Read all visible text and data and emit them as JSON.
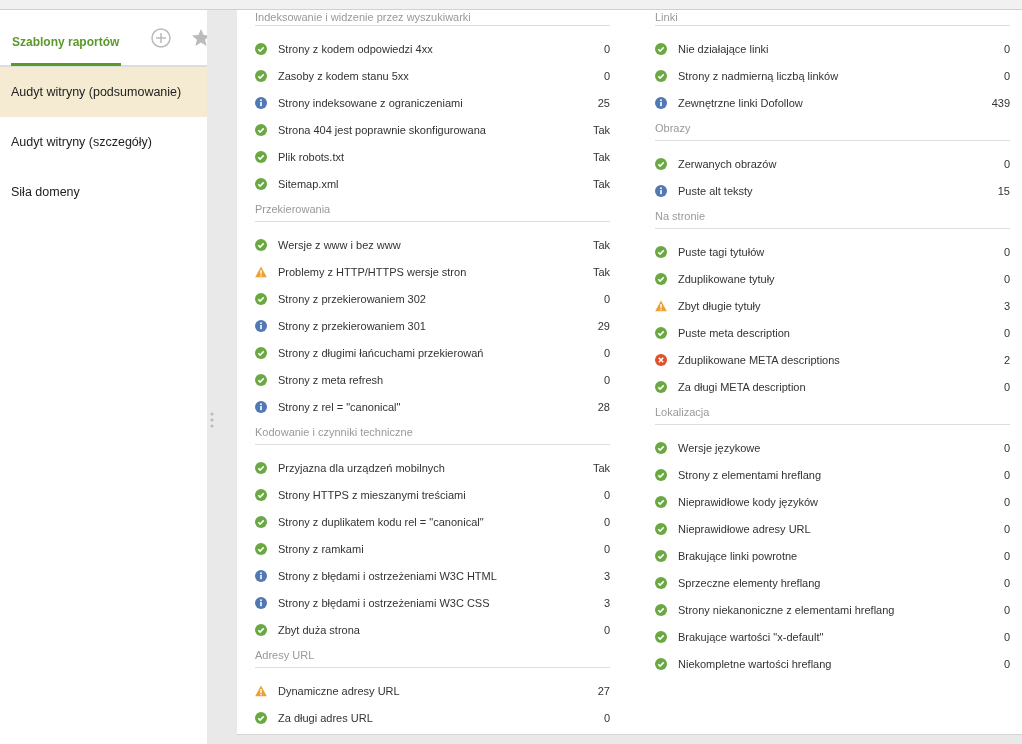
{
  "sidebar": {
    "tabs": [
      {
        "label": "Szablony raportów",
        "selected": true
      }
    ],
    "items": [
      {
        "label": "Audyt witryny (podsumowanie)",
        "selected": true
      },
      {
        "label": "Audyt witryny (szczegóły)",
        "selected": false
      },
      {
        "label": "Siła domeny",
        "selected": false
      }
    ]
  },
  "report": {
    "left_column": [
      {
        "title": "Indeksowanie i widzenie przez wyszukiwarki",
        "rows": [
          {
            "kind": "ok",
            "label": "Strony z kodem odpowiedzi 4xx",
            "value": "0"
          },
          {
            "kind": "ok",
            "label": "Zasoby z kodem stanu 5xx",
            "value": "0"
          },
          {
            "kind": "info",
            "label": "Strony indeksowane z ograniczeniami",
            "value": "25"
          },
          {
            "kind": "ok",
            "label": "Strona 404 jest poprawnie skonfigurowana",
            "value": "Tak"
          },
          {
            "kind": "ok",
            "label": "Plik robots.txt",
            "value": "Tak"
          },
          {
            "kind": "ok",
            "label": "Sitemap.xml",
            "value": "Tak"
          }
        ]
      },
      {
        "title": "Przekierowania",
        "rows": [
          {
            "kind": "ok",
            "label": "Wersje z www i bez www",
            "value": "Tak"
          },
          {
            "kind": "warning",
            "label": "Problemy z HTTP/HTTPS wersje stron",
            "value": "Tak"
          },
          {
            "kind": "ok",
            "label": "Strony z przekierowaniem 302",
            "value": "0"
          },
          {
            "kind": "info",
            "label": "Strony z przekierowaniem 301",
            "value": "29"
          },
          {
            "kind": "ok",
            "label": "Strony z długimi łańcuchami przekierowań",
            "value": "0"
          },
          {
            "kind": "ok",
            "label": "Strony z meta refresh",
            "value": "0"
          },
          {
            "kind": "info",
            "label": "Strony z rel = \"canonical\"",
            "value": "28"
          }
        ]
      },
      {
        "title": "Kodowanie i czynniki techniczne",
        "rows": [
          {
            "kind": "ok",
            "label": "Przyjazna dla urządzeń mobilnych",
            "value": "Tak"
          },
          {
            "kind": "ok",
            "label": "Strony HTTPS z mieszanymi treściami",
            "value": "0"
          },
          {
            "kind": "ok",
            "label": "Strony z duplikatem kodu rel = \"canonical\"",
            "value": "0"
          },
          {
            "kind": "ok",
            "label": "Strony z ramkami",
            "value": "0"
          },
          {
            "kind": "info",
            "label": "Strony z błędami i ostrzeżeniami W3C HTML",
            "value": "3"
          },
          {
            "kind": "info",
            "label": "Strony z błędami i ostrzeżeniami W3C CSS",
            "value": "3"
          },
          {
            "kind": "ok",
            "label": "Zbyt duża strona",
            "value": "0"
          }
        ]
      },
      {
        "title": "Adresy URL",
        "rows": [
          {
            "kind": "warning",
            "label": "Dynamiczne adresy URL",
            "value": "27"
          },
          {
            "kind": "ok",
            "label": "Za długi adres URL",
            "value": "0"
          }
        ]
      }
    ],
    "right_column": [
      {
        "title": "Linki",
        "rows": [
          {
            "kind": "ok",
            "label": "Nie działające linki",
            "value": "0"
          },
          {
            "kind": "ok",
            "label": "Strony z nadmierną liczbą linków",
            "value": "0"
          },
          {
            "kind": "info",
            "label": "Zewnętrzne linki Dofollow",
            "value": "439"
          }
        ]
      },
      {
        "title": "Obrazy",
        "rows": [
          {
            "kind": "ok",
            "label": "Zerwanych obrazów",
            "value": "0"
          },
          {
            "kind": "info",
            "label": "Puste alt teksty",
            "value": "15"
          }
        ]
      },
      {
        "title": "Na stronie",
        "rows": [
          {
            "kind": "ok",
            "label": "Puste tagi tytułów",
            "value": "0"
          },
          {
            "kind": "ok",
            "label": "Zduplikowane tytuły",
            "value": "0"
          },
          {
            "kind": "warning",
            "label": "Zbyt długie tytuły",
            "value": "3"
          },
          {
            "kind": "ok",
            "label": "Puste meta description",
            "value": "0"
          },
          {
            "kind": "error",
            "label": "Zduplikowane META descriptions",
            "value": "2"
          },
          {
            "kind": "ok",
            "label": "Za długi META description",
            "value": "0"
          }
        ]
      },
      {
        "title": "Lokalizacja",
        "rows": [
          {
            "kind": "ok",
            "label": "Wersje językowe",
            "value": "0"
          },
          {
            "kind": "ok",
            "label": "Strony z elementami hreflang",
            "value": "0"
          },
          {
            "kind": "ok",
            "label": "Nieprawidłowe kody języków",
            "value": "0"
          },
          {
            "kind": "ok",
            "label": "Nieprawidłowe adresy URL",
            "value": "0"
          },
          {
            "kind": "ok",
            "label": "Brakujące linki powrotne",
            "value": "0"
          },
          {
            "kind": "ok",
            "label": "Sprzeczne elementy hreflang",
            "value": "0"
          },
          {
            "kind": "ok",
            "label": "Strony niekanoniczne z elementami hreflang",
            "value": "0"
          },
          {
            "kind": "ok",
            "label": "Brakujące wartości \"x-default\"",
            "value": "0"
          },
          {
            "kind": "ok",
            "label": "Niekompletne wartości hreflang",
            "value": "0"
          }
        ]
      }
    ]
  }
}
